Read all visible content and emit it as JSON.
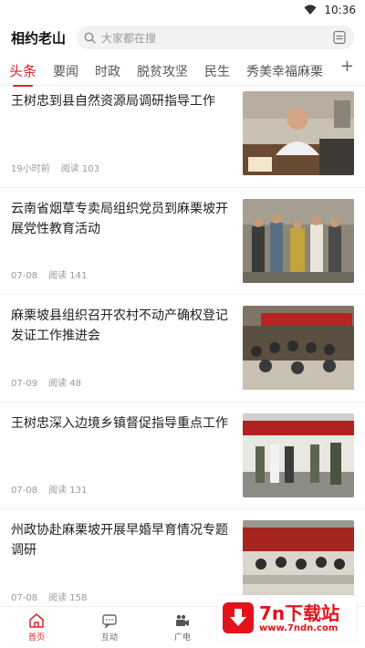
{
  "status": {
    "time": "10:36"
  },
  "header": {
    "title": "相约老山",
    "search_placeholder": "大家都在搜"
  },
  "tabs": [
    {
      "label": "头条",
      "active": true
    },
    {
      "label": "要闻"
    },
    {
      "label": "时政"
    },
    {
      "label": "脱贫攻坚"
    },
    {
      "label": "民生"
    },
    {
      "label": "秀美幸福麻栗"
    }
  ],
  "tabs_more": "+",
  "articles": [
    {
      "title": "王树忠到县自然资源局调研指导工作",
      "time": "19小时前",
      "reads": "阅读 103"
    },
    {
      "title": "云南省烟草专卖局组织党员到麻栗坡开展党性教育活动",
      "time": "07-08",
      "reads": "阅读 141"
    },
    {
      "title": "麻栗坡县组织召开农村不动产确权登记发证工作推进会",
      "time": "07-09",
      "reads": "阅读 48"
    },
    {
      "title": "王树忠深入边境乡镇督促指导重点工作",
      "time": "07-08",
      "reads": "阅读 131"
    },
    {
      "title": "州政协赴麻栗坡开展早婚早育情况专题调研",
      "time": "07-08",
      "reads": "阅读 158"
    }
  ],
  "bottom_nav": [
    {
      "label": "首页",
      "active": true
    },
    {
      "label": "互动"
    },
    {
      "label": "广电"
    }
  ],
  "watermark": {
    "name": "7n下载站",
    "url": "www.7ndn.com"
  },
  "colors": {
    "accent": "#d7262f",
    "watermark": "#e2141b"
  }
}
